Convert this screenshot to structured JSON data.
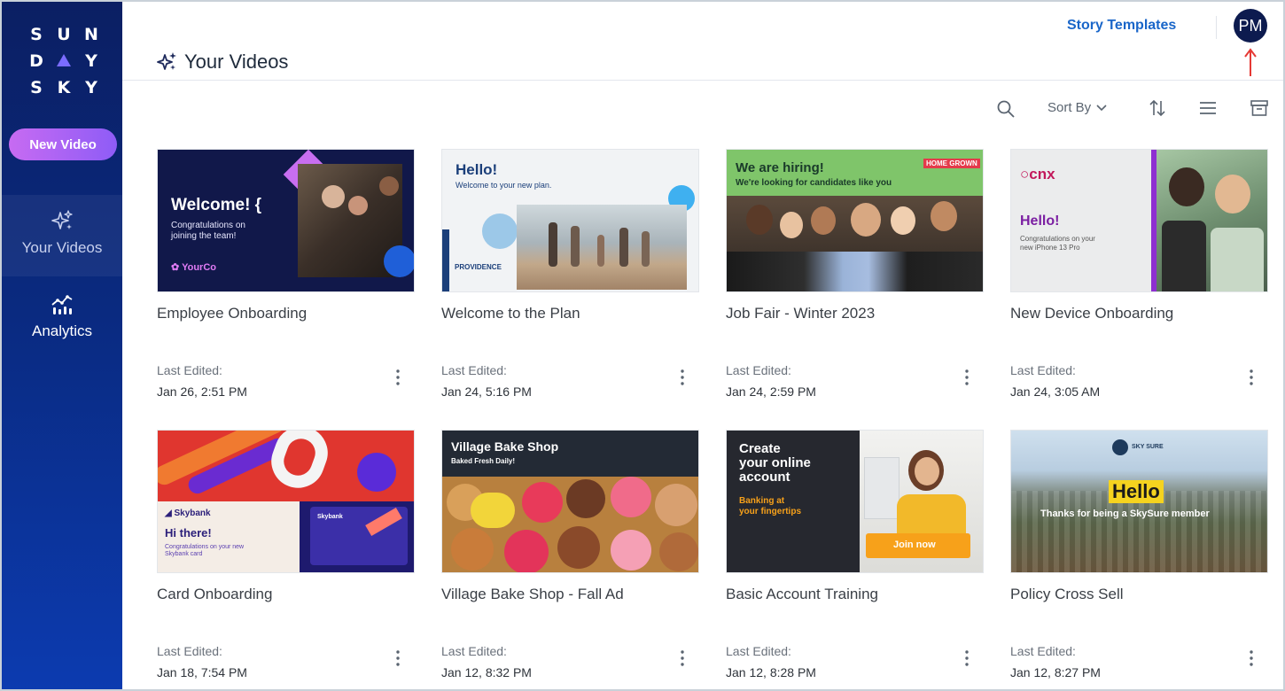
{
  "colors": {
    "sidebar_top": "#0b1f63",
    "sidebar_bottom": "#0c3bb0",
    "new_video_start": "#c76bf2",
    "new_video_end": "#8e5cf6",
    "link_blue": "#1a66c9",
    "avatar_bg": "#0d1b4f",
    "annotation_red": "#e53935"
  },
  "sidebar": {
    "logo_rows": [
      [
        "S",
        "U",
        "N"
      ],
      [
        "D",
        "",
        "Y"
      ],
      [
        "S",
        "K",
        "Y"
      ]
    ],
    "new_video_label": "New Video",
    "nav": [
      {
        "label": "Your Videos",
        "icon": "sparkle-icon",
        "active": true
      },
      {
        "label": "Analytics",
        "icon": "analytics-icon",
        "active": false
      }
    ]
  },
  "header": {
    "title": "Your Videos",
    "title_icon": "sparkle-icon",
    "story_templates_label": "Story Templates",
    "avatar_initials": "PM"
  },
  "toolbar": {
    "search_icon": "search-icon",
    "sort_label": "Sort By",
    "order_icon": "sort-order-icon",
    "view_icon": "list-view-icon",
    "archive_icon": "archive-icon"
  },
  "last_edited_label": "Last Edited:",
  "videos": [
    {
      "title": "Employee Onboarding",
      "date": "Jan 26, 2:51 PM",
      "thumb": {
        "headline": "Welcome! {",
        "sub1": "Congratulations on",
        "sub2": "joining the team!",
        "brand": "YourCo"
      }
    },
    {
      "title": "Welcome to the Plan",
      "date": "Jan 24, 5:16 PM",
      "thumb": {
        "headline": "Hello!",
        "sub1": "Welcome to your new plan.",
        "brand": "PROVIDENCE"
      }
    },
    {
      "title": "Job Fair - Winter 2023",
      "date": "Jan 24, 2:59 PM",
      "thumb": {
        "headline": "We are hiring!",
        "sub1": "We're looking for candidates like you",
        "brand": "HOME GROWN"
      }
    },
    {
      "title": "New Device Onboarding",
      "date": "Jan 24, 3:05 AM",
      "thumb": {
        "brand": "cnx",
        "headline": "Hello!",
        "sub1": "Congratulations on your",
        "sub2": "new iPhone 13 Pro"
      }
    },
    {
      "title": "Card Onboarding",
      "date": "Jan 18, 7:54 PM",
      "thumb": {
        "brand": "Skybank",
        "headline": "Hi there!",
        "sub1": "Congratulations on your new",
        "sub2": "Skybank card",
        "card_brand": "Skybank"
      }
    },
    {
      "title": "Village Bake Shop - Fall Ad",
      "date": "Jan 12, 8:32 PM",
      "thumb": {
        "headline": "Village Bake Shop",
        "sub1": "Baked Fresh Daily!"
      }
    },
    {
      "title": "Basic Account Training",
      "date": "Jan 12, 8:28 PM",
      "thumb": {
        "headline1": "Create",
        "headline2": "your online",
        "headline3": "account",
        "sub1": "Banking at",
        "sub2": "your fingertips",
        "cta": "Join now"
      }
    },
    {
      "title": "Policy Cross Sell",
      "date": "Jan 12, 8:27 PM",
      "thumb": {
        "brand": "SKY SURE",
        "headline": "Hello",
        "sub1": "Thanks for being a SkySure member"
      }
    }
  ]
}
